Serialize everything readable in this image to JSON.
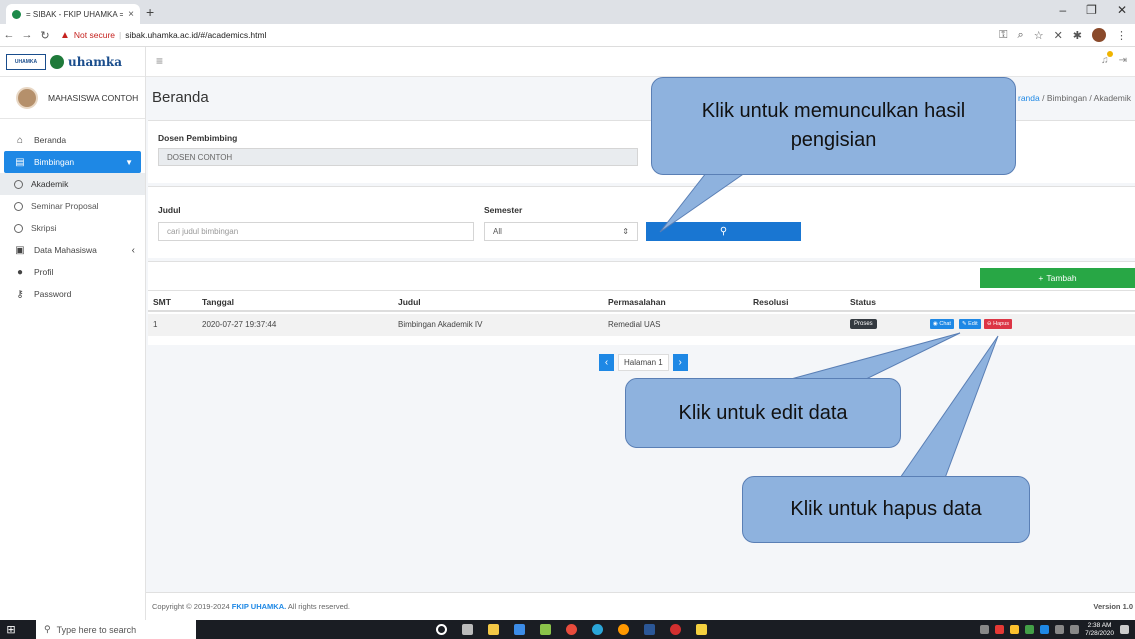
{
  "browser": {
    "tab_title": "= SIBAK - FKIP UHAMKA =",
    "new_tab": "+",
    "not_secure": "Not secure",
    "url": "sibak.uhamka.ac.id/#/academics.html"
  },
  "brand": {
    "logo_text": "UHAMKA",
    "name": "uhamka"
  },
  "user": {
    "name": "MAHASISWA CONTOH"
  },
  "sidebar": {
    "items": [
      {
        "label": "Beranda",
        "icon": "home-icon"
      },
      {
        "label": "Bimbingan",
        "icon": "book-icon"
      },
      {
        "label": "Akademik",
        "icon": "circle-icon"
      },
      {
        "label": "Seminar Proposal",
        "icon": "circle-icon"
      },
      {
        "label": "Skripsi",
        "icon": "circle-icon"
      },
      {
        "label": "Data Mahasiswa",
        "icon": "id-card-icon"
      },
      {
        "label": "Profil",
        "icon": "user-icon"
      },
      {
        "label": "Password",
        "icon": "key-icon"
      }
    ]
  },
  "page": {
    "title": "Beranda",
    "breadcrumb": [
      "randa",
      "Bimbingan",
      "Akademik"
    ]
  },
  "advisor": {
    "label": "Dosen Pembimbing",
    "value": "DOSEN CONTOH"
  },
  "filter": {
    "judul_label": "Judul",
    "judul_placeholder": "cari judul bimbingan",
    "semester_label": "Semester",
    "semester_value": "All"
  },
  "table": {
    "add_label": "Tambah",
    "headers": [
      "SMT",
      "Tanggal",
      "Judul",
      "Permasalahan",
      "Resolusi",
      "Status"
    ],
    "rows": [
      {
        "smt": "1",
        "tanggal": "2020-07-27 19:37:44",
        "judul": "Bimbingan Akademik IV",
        "permasalahan": "Remedial UAS",
        "resolusi": "",
        "status": "Proses"
      }
    ],
    "actions": {
      "chat": "Chat",
      "edit": "Edit",
      "hapus": "Hapus"
    }
  },
  "pager": {
    "label": "Halaman 1"
  },
  "footer": {
    "copyright_prefix": "Copyright © 2019-2024",
    "brand": "FKIP UHAMKA.",
    "suffix": "All rights reserved.",
    "version": "Version 1.0"
  },
  "callouts": {
    "show_results": "Klik untuk memunculkan hasil pengisian",
    "edit": "Klik untuk edit data",
    "delete": "Klik untuk hapus data"
  },
  "taskbar": {
    "search_placeholder": "Type here to search",
    "time": "2:38 AM",
    "date": "7/28/2020"
  },
  "colors": {
    "primary": "#1e88e5",
    "success": "#28a745",
    "danger": "#dc3545",
    "callout": "#8eb2de"
  }
}
